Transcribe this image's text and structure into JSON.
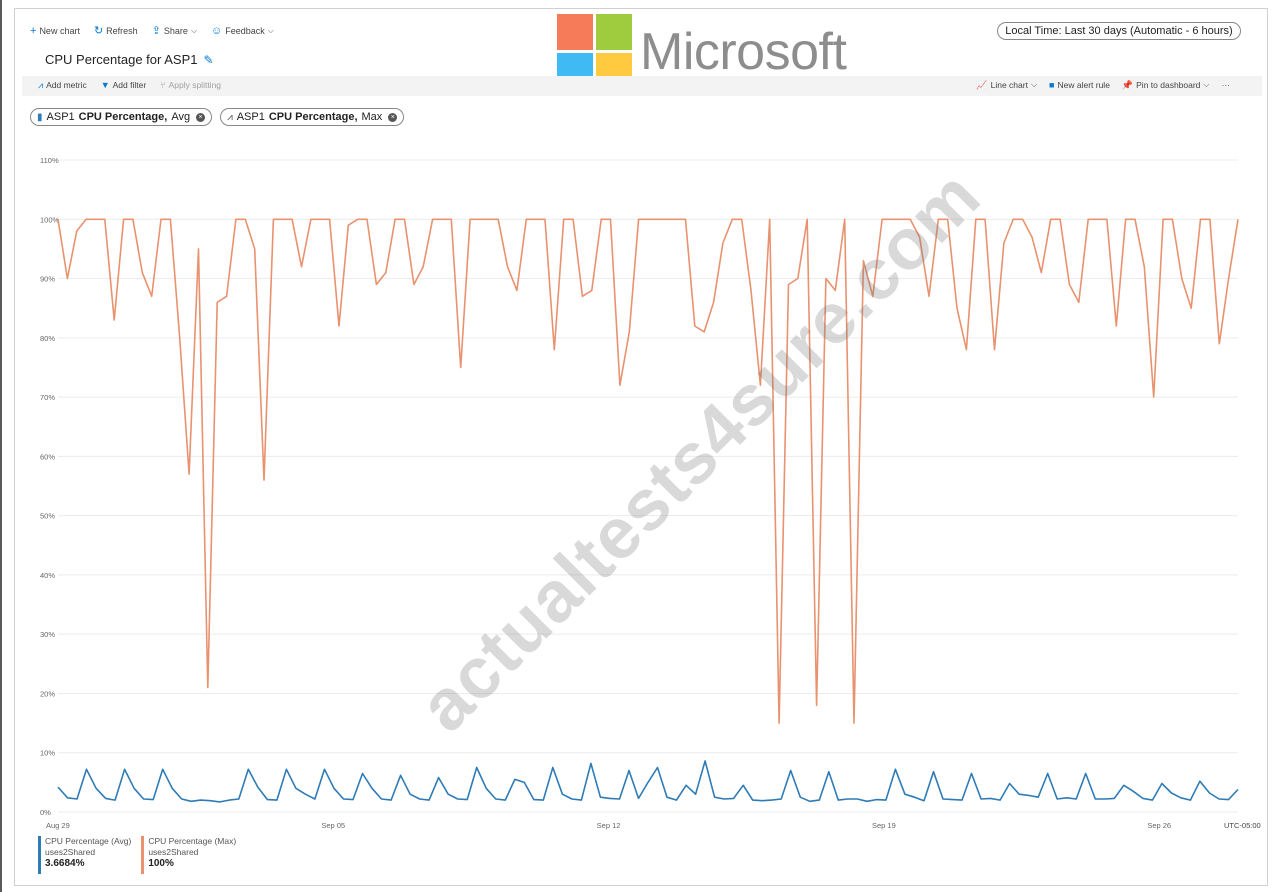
{
  "toolbar": {
    "new_chart": "New chart",
    "refresh": "Refresh",
    "share": "Share",
    "feedback": "Feedback"
  },
  "logo_text": "Microsoft",
  "time_range": "Local Time: Last 30 days (Automatic - 6 hours)",
  "title": "CPU Percentage for ASP1",
  "subbar": {
    "add_metric": "Add metric",
    "add_filter": "Add filter",
    "apply_splitting": "Apply splitting",
    "line_chart": "Line chart",
    "new_alert_rule": "New alert rule",
    "pin_to_dashboard": "Pin to dashboard",
    "more": "···"
  },
  "pills": [
    {
      "resource": "ASP1",
      "metric": "CPU Percentage,",
      "agg": "Avg"
    },
    {
      "resource": "ASP1",
      "metric": "CPU Percentage,",
      "agg": "Max"
    }
  ],
  "watermark": "actualtests4sure.com",
  "legend": [
    {
      "name": "CPU Percentage (Avg)",
      "sub": "uses2Shared",
      "value": "3.6684%"
    },
    {
      "name": "CPU Percentage (Max)",
      "sub": "uses2Shared",
      "value": "100%"
    }
  ],
  "colors": {
    "avg": "#2e7bb5",
    "max": "#e8926f",
    "accent": "#0078d4"
  },
  "chart_data": {
    "type": "line",
    "yticks": [
      "110%",
      "100%",
      "90%",
      "80%",
      "70%",
      "60%",
      "50%",
      "40%",
      "30%",
      "20%",
      "10%",
      "0%"
    ],
    "ylim": [
      0,
      110
    ],
    "xticks": [
      {
        "label": "Aug 29",
        "x": 0
      },
      {
        "label": "Sep 05",
        "x": 28
      },
      {
        "label": "Sep 12",
        "x": 56
      },
      {
        "label": "Sep 19",
        "x": 84
      },
      {
        "label": "Sep 26",
        "x": 112
      }
    ],
    "timezone": "UTC-05:00",
    "xlim": [
      0,
      120
    ],
    "series": [
      {
        "name": "CPU Percentage (Max)",
        "color": "#e8926f",
        "values": [
          100,
          90,
          98,
          100,
          100,
          100,
          83,
          100,
          100,
          91,
          87,
          100,
          100,
          80,
          57,
          95,
          21,
          86,
          87,
          100,
          100,
          95,
          56,
          100,
          100,
          100,
          92,
          100,
          100,
          100,
          82,
          99,
          100,
          100,
          89,
          91,
          100,
          100,
          89,
          92,
          100,
          100,
          100,
          75,
          100,
          100,
          100,
          100,
          92,
          88,
          100,
          100,
          100,
          78,
          100,
          100,
          87,
          88,
          100,
          100,
          72,
          81,
          100,
          100,
          100,
          100,
          100,
          100,
          82,
          81,
          86,
          96,
          100,
          100,
          88,
          72,
          100,
          15,
          89,
          90,
          100,
          18,
          90,
          88,
          100,
          15,
          93,
          87,
          100,
          100,
          100,
          100,
          97,
          87,
          100,
          100,
          85,
          78,
          100,
          100,
          78,
          96,
          100,
          100,
          97,
          91,
          100,
          100,
          89,
          86,
          100,
          100,
          100,
          82,
          100,
          100,
          92,
          70,
          100,
          100,
          90,
          85,
          100,
          100,
          79,
          90,
          100
        ]
      },
      {
        "name": "CPU Percentage (Avg)",
        "color": "#2e7bb5",
        "values": [
          4.2,
          2.4,
          2.2,
          7.2,
          4,
          2.3,
          2,
          7.2,
          4,
          2.2,
          2.1,
          7.2,
          4,
          2.2,
          1.8,
          2,
          1.9,
          1.7,
          2,
          2.2,
          7.2,
          4.2,
          2.1,
          2,
          7.2,
          4,
          3,
          2.2,
          7.2,
          4,
          2.2,
          2.1,
          6.5,
          4,
          2.2,
          2,
          6.2,
          3,
          2.2,
          2,
          5.8,
          3,
          2.2,
          2.1,
          7.5,
          4,
          2.2,
          2,
          5.5,
          5,
          2.1,
          2,
          7.5,
          3,
          2.2,
          2,
          8.2,
          2.5,
          2.3,
          2.2,
          7,
          2.3,
          5,
          7.5,
          2.5,
          2,
          4.5,
          3,
          8.6,
          2.5,
          2.2,
          2.3,
          4.5,
          2,
          1.9,
          2,
          2.2,
          7,
          2.5,
          1.8,
          2,
          6.8,
          2,
          2.2,
          2.2,
          1.8,
          2.1,
          2,
          7.2,
          3,
          2.5,
          1.9,
          6.8,
          2.2,
          2.1,
          2,
          6.5,
          2.2,
          2.3,
          2,
          4.8,
          3,
          2.8,
          2.5,
          6.5,
          2.2,
          2.4,
          2.2,
          6.5,
          2.2,
          2.2,
          2.3,
          4.5,
          3.5,
          2.3,
          2,
          4.8,
          3.2,
          2.4,
          2,
          5.2,
          3.2,
          2.2,
          2.1,
          3.8
        ]
      }
    ]
  }
}
